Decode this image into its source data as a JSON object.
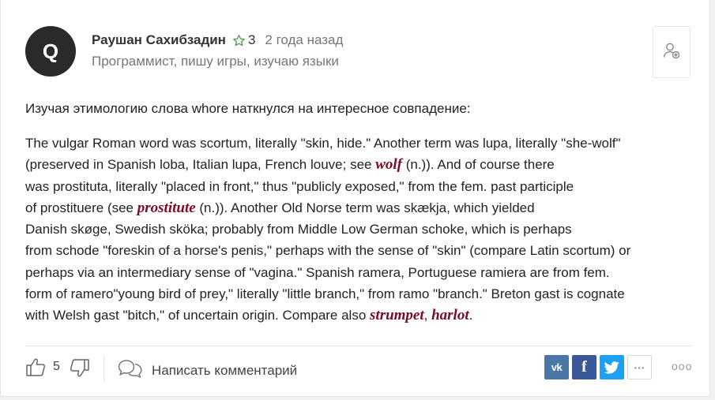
{
  "author": {
    "avatar_letter": "Q",
    "avatar_color": "#2a2a2a",
    "name": "Раушан Сахибзадин",
    "rating": "3",
    "time": "2 года назад",
    "bio": "Программист, пишу игры, изучаю языки",
    "icons": [
      "star-outline-icon",
      "add-user-icon"
    ]
  },
  "post": {
    "intro": "Изучая этимологию слова whore наткнулся на интересное совпадение:",
    "l1": "The vulgar Roman word was scortum, literally \"skin, hide.\" Another term was lupa, literally \"she-wolf\"",
    "l2a": "(preserved in Spanish loba, Italian lupa, French louve; see ",
    "l2term": "wolf",
    "l2b": " (n.)). And of course there",
    "l3": "was prostituta, literally \"placed in front,\" thus \"publicly exposed,\" from the fem. past participle",
    "l4a": "of prostituere (see ",
    "l4term": "prostitute",
    "l4b": " (n.)). Another Old Norse term was skækja, which yielded",
    "l5": "Danish skøge, Swedish sköka; probably from Middle Low German schoke, which is perhaps",
    "l6": "from schode \"foreskin of a horse's penis,\" perhaps with the sense of \"skin\" (compare Latin scortum) or",
    "l7": "perhaps via an intermediary sense of \"vagina.\" Spanish ramera, Portuguese ramiera are from fem.",
    "l8": "form of ramero\"young bird of prey,\" literally \"little branch,\" from ramo \"branch.\" Breton gast is cognate",
    "l9a": "with Welsh gast \"bitch,\" of uncertain origin. Compare also ",
    "l9term1": "strumpet",
    "l9sep": ", ",
    "l9term2": "harlot",
    "l9end": ".",
    "term_color": "#7a0b22"
  },
  "footer": {
    "likes": "5",
    "comment_label": "Написать комментарий",
    "share_vk": "vk",
    "share_fb": "f",
    "share_more": "···",
    "more_actions": "ooo",
    "icons": [
      "thumb-up-icon",
      "thumb-down-icon",
      "comment-bubble-icon",
      "twitter-bird-icon"
    ],
    "colors": {
      "vk": "#4a76a8",
      "facebook": "#3b5998",
      "twitter": "#1da1f2"
    }
  }
}
